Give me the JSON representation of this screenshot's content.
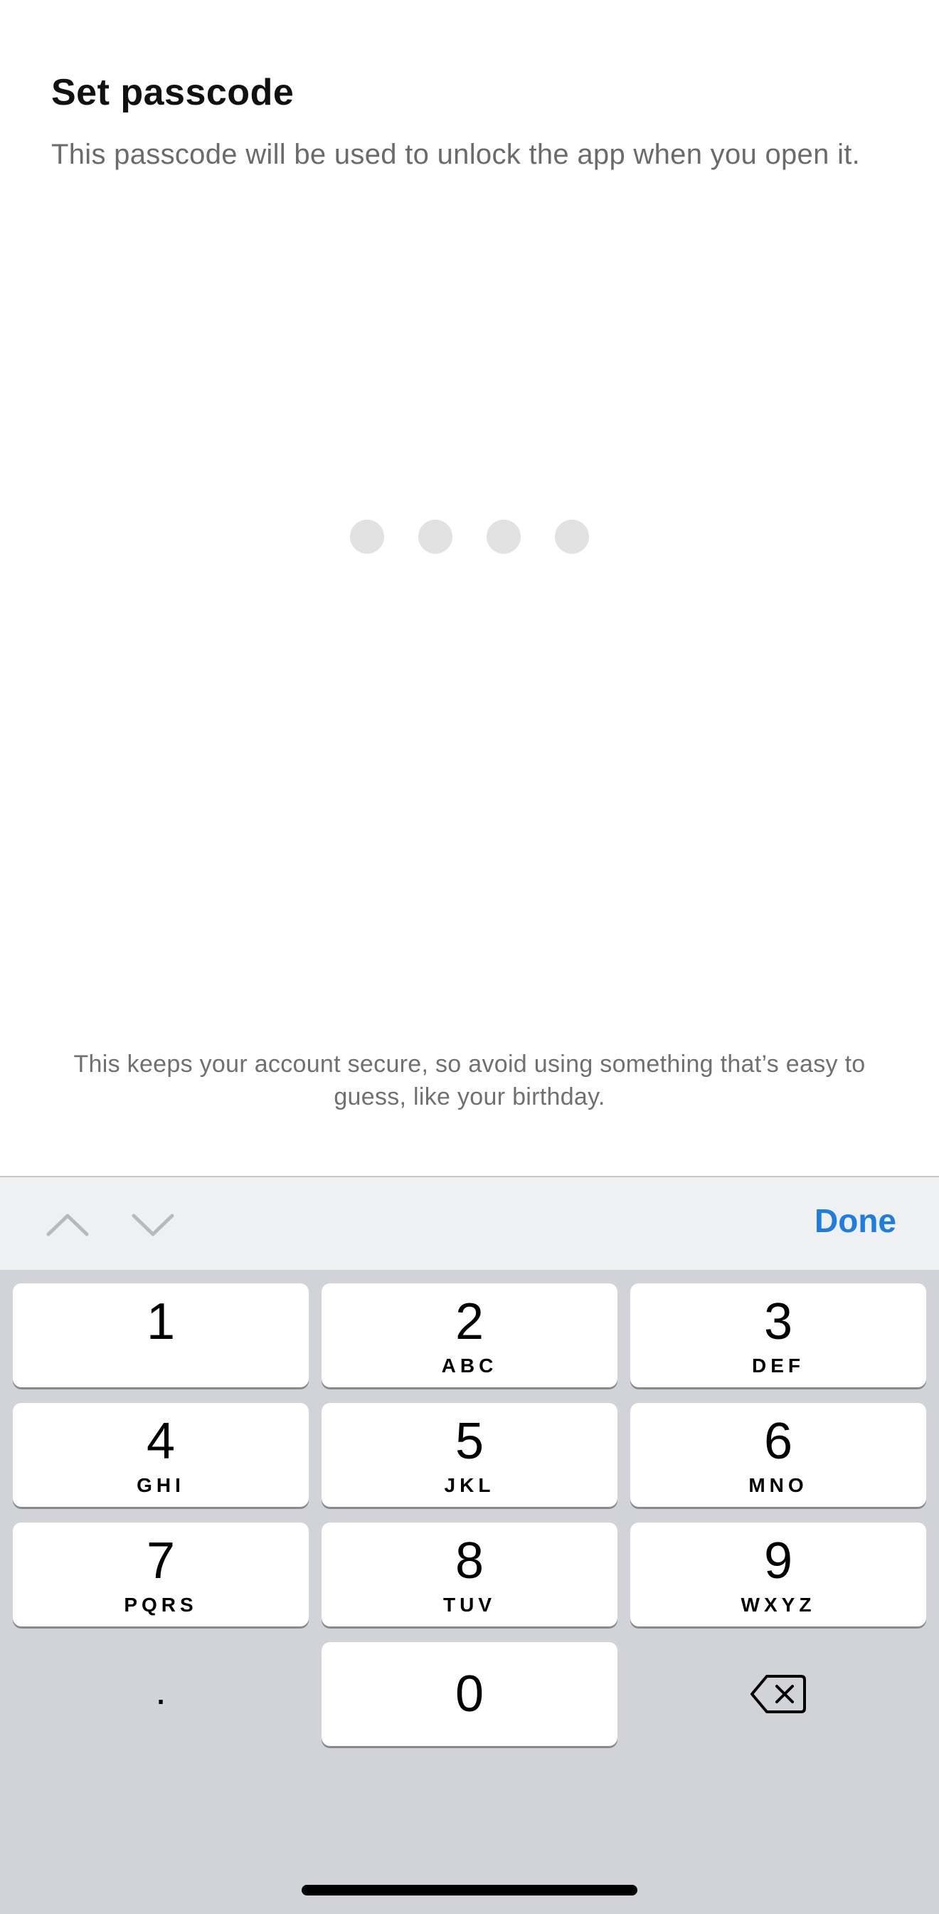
{
  "header": {
    "title": "Set passcode",
    "subtitle": "This passcode will be used to unlock the app when you open it."
  },
  "passcode": {
    "length": 4,
    "entered": 0
  },
  "hint": "This keeps your account secure, so avoid using something that’s easy to guess, like your birthday.",
  "accessory_bar": {
    "previous_icon": "chevron-up-icon",
    "next_icon": "chevron-down-icon",
    "done_label": "Done",
    "done_color": "#1e7ee0"
  },
  "keypad": {
    "keys": [
      {
        "digit": "1",
        "letters": ""
      },
      {
        "digit": "2",
        "letters": "ABC"
      },
      {
        "digit": "3",
        "letters": "DEF"
      },
      {
        "digit": "4",
        "letters": "GHI"
      },
      {
        "digit": "5",
        "letters": "JKL"
      },
      {
        "digit": "6",
        "letters": "MNO"
      },
      {
        "digit": "7",
        "letters": "PQRS"
      },
      {
        "digit": "8",
        "letters": "TUV"
      },
      {
        "digit": "9",
        "letters": "WXYZ"
      }
    ],
    "decimal": ".",
    "zero": "0",
    "backspace_icon": "backspace-icon"
  }
}
